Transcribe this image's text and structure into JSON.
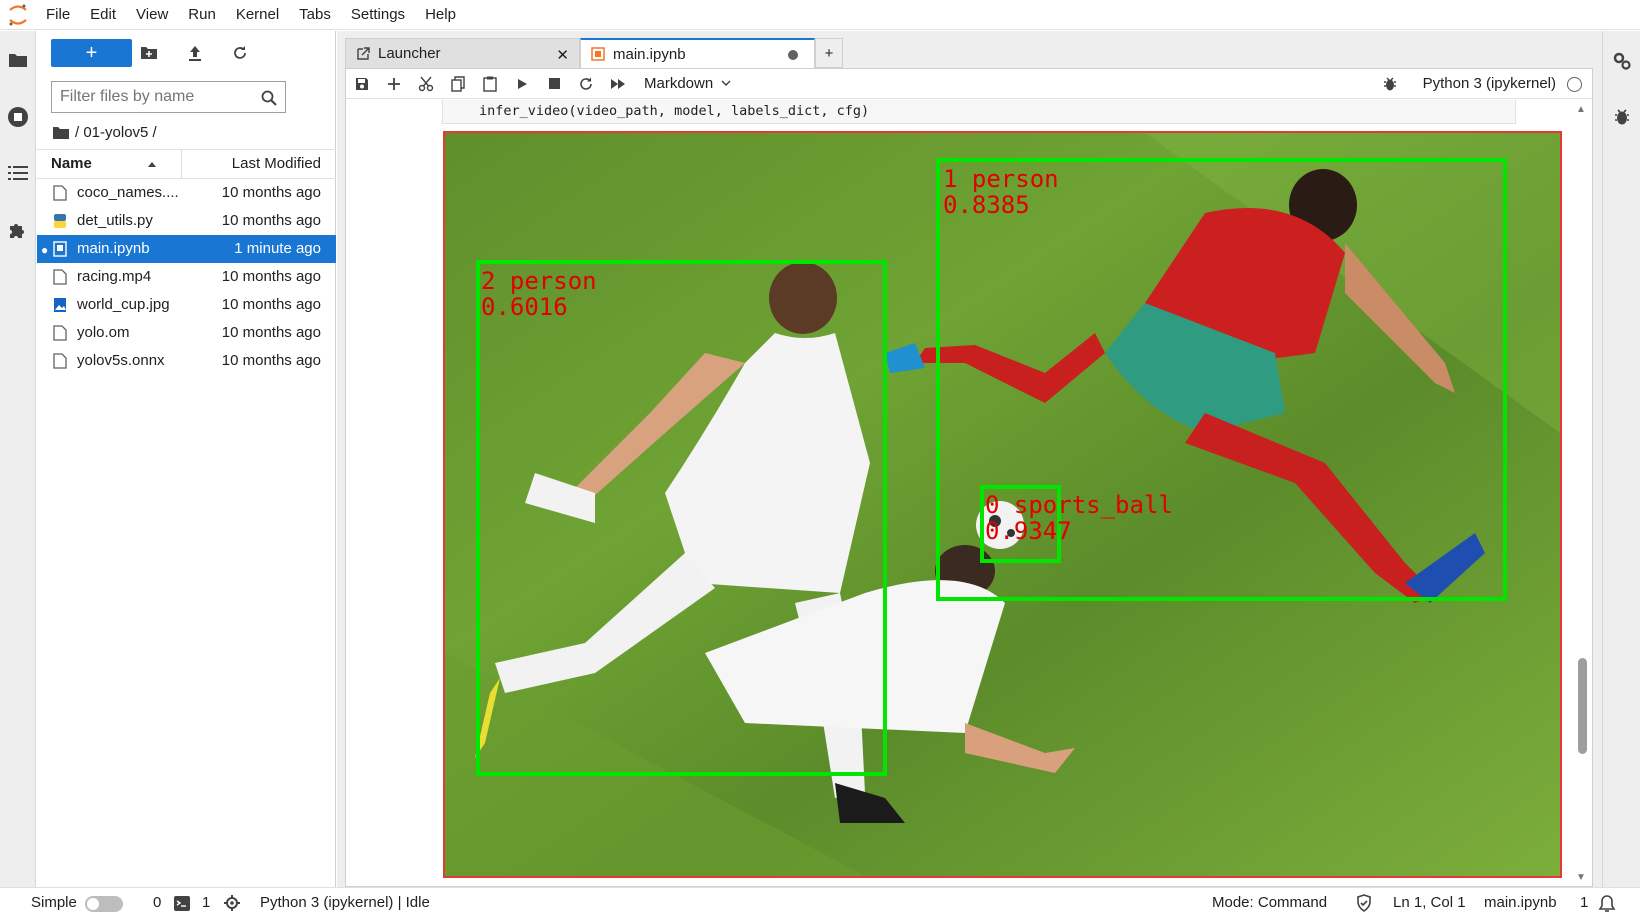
{
  "menu": [
    "File",
    "Edit",
    "View",
    "Run",
    "Kernel",
    "Tabs",
    "Settings",
    "Help"
  ],
  "filebrowser": {
    "new_label": "+",
    "filter_placeholder": "Filter files by name",
    "breadcrumb": "/ 01-yolov5 /",
    "col_name": "Name",
    "col_modified": "Last Modified",
    "files": [
      {
        "name": "coco_names....",
        "modified": "10 months ago",
        "type": "file"
      },
      {
        "name": "det_utils.py",
        "modified": "10 months ago",
        "type": "python"
      },
      {
        "name": "main.ipynb",
        "modified": "1 minute ago",
        "type": "notebook",
        "selected": true
      },
      {
        "name": "racing.mp4",
        "modified": "10 months ago",
        "type": "file"
      },
      {
        "name": "world_cup.jpg",
        "modified": "10 months ago",
        "type": "image"
      },
      {
        "name": "yolo.om",
        "modified": "10 months ago",
        "type": "file"
      },
      {
        "name": "yolov5s.onnx",
        "modified": "10 months ago",
        "type": "file"
      }
    ]
  },
  "tabs": {
    "launcher": "Launcher",
    "main": "main.ipynb",
    "add": "+"
  },
  "notebook": {
    "cell_type": "Markdown",
    "kernel": "Python 3 (ipykernel)",
    "code": "infer_video(video_path, model, labels_dict, cfg)",
    "detections": [
      {
        "label": "1 person",
        "score": "0.8385"
      },
      {
        "label": "2 person",
        "score": "0.6016"
      },
      {
        "label": "0 sports_ball",
        "score": "0.9347"
      }
    ]
  },
  "statusbar": {
    "mode_label": "Simple",
    "terminals": "0",
    "kernels": "1",
    "kernel_status": "Python 3 (ipykernel) | Idle",
    "mode": "Mode: Command",
    "position": "Ln 1, Col 1",
    "file": "main.ipynb",
    "notifications": "1"
  },
  "colors": {
    "accent": "#1976d2",
    "box": "#00e600",
    "label": "#e00000",
    "border": "#e53935"
  }
}
